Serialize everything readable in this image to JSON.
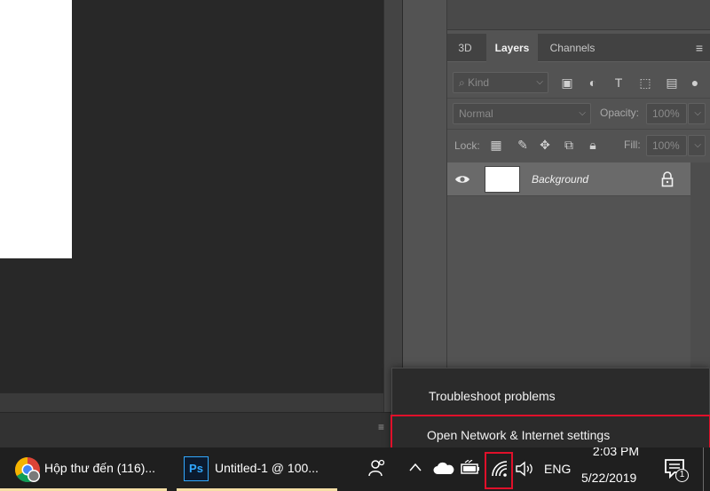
{
  "layers_panel": {
    "tabs": [
      {
        "label": "3D"
      },
      {
        "label": "Layers"
      },
      {
        "label": "Channels"
      }
    ],
    "filter": {
      "placeholder": "Kind"
    },
    "blend_mode": "Normal",
    "opacity": {
      "label": "Opacity:",
      "value": "100%"
    },
    "lock_label": "Lock:",
    "fill": {
      "label": "Fill:",
      "value": "100%"
    },
    "layers": [
      {
        "name": "Background",
        "visible": true,
        "locked": true
      }
    ]
  },
  "context_menu": {
    "items": [
      {
        "label": "Troubleshoot problems"
      },
      {
        "label": "Open Network & Internet settings"
      }
    ]
  },
  "taskbar": {
    "apps": [
      {
        "label": "Hộp thư đến (116)...",
        "icon": "chrome-icon"
      },
      {
        "label": "Untitled-1 @ 100...",
        "icon": "photoshop-icon",
        "logo_text": "Ps"
      }
    ],
    "language": "ENG",
    "time": "2:03 PM",
    "date": "5/22/2019",
    "notification_count": "1"
  },
  "colors": {
    "highlight_border": "#e0102a",
    "taskbar_underline": "#f6dfa6",
    "photoshop_blue": "#31a8ff"
  }
}
